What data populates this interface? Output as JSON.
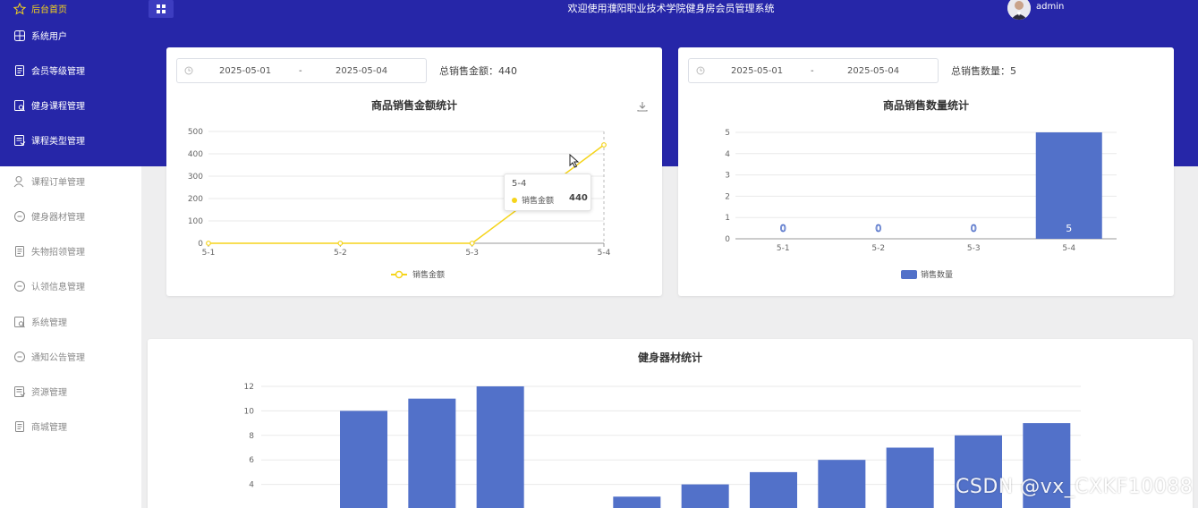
{
  "app": {
    "title": "欢迎使用濮阳职业技术学院健身房会员管理系统",
    "username": "admin",
    "brand_color": "#2626a8"
  },
  "sidebar": {
    "items": [
      {
        "label": "后台首页",
        "icon": "star-icon"
      },
      {
        "label": "系统用户",
        "icon": "grid-icon"
      },
      {
        "label": "会员等级管理",
        "icon": "document-icon"
      },
      {
        "label": "健身课程管理",
        "icon": "file-search-icon"
      },
      {
        "label": "课程类型管理",
        "icon": "file-list-icon"
      },
      {
        "label": "课程订单管理",
        "icon": "user-icon"
      },
      {
        "label": "健身器材管理",
        "icon": "chat-icon"
      },
      {
        "label": "失物招领管理",
        "icon": "document-icon"
      },
      {
        "label": "认领信息管理",
        "icon": "chat-icon"
      },
      {
        "label": "系统管理",
        "icon": "file-search-icon"
      },
      {
        "label": "通知公告管理",
        "icon": "chat-icon"
      },
      {
        "label": "资源管理",
        "icon": "file-list-icon"
      },
      {
        "label": "商城管理",
        "icon": "document-icon"
      }
    ]
  },
  "sales_amount_card": {
    "date_start": "2025-05-01",
    "date_sep": "-",
    "date_end": "2025-05-04",
    "total_label": "总销售金额：440",
    "tooltip": {
      "title": "5-4",
      "series": "销售金额",
      "value": "440"
    }
  },
  "sales_qty_card": {
    "date_start": "2025-05-01",
    "date_sep": "-",
    "date_end": "2025-05-04",
    "total_label": "总销售数量：5"
  },
  "chart_data": [
    {
      "type": "line",
      "title": "商品销售金额统计",
      "categories": [
        "5-1",
        "5-2",
        "5-3",
        "5-4"
      ],
      "series": [
        {
          "name": "销售金额",
          "values": [
            0,
            0,
            0,
            440
          ],
          "color": "#f5d41b"
        }
      ],
      "yticks": [
        0,
        100,
        200,
        300,
        400,
        500
      ],
      "ylim": [
        0,
        500
      ],
      "legend": "bottom-center",
      "grid": true
    },
    {
      "type": "bar",
      "title": "商品销售数量统计",
      "categories": [
        "5-1",
        "5-2",
        "5-3",
        "5-4"
      ],
      "series": [
        {
          "name": "销售数量",
          "values": [
            0,
            0,
            0,
            5
          ],
          "color": "#5271c9"
        }
      ],
      "yticks": [
        0,
        1,
        2,
        3,
        4,
        5
      ],
      "ylim": [
        0,
        5
      ],
      "legend": "bottom-center",
      "data_labels": [
        "0",
        "0",
        "0",
        "5"
      ],
      "grid": true
    },
    {
      "type": "bar",
      "title": "健身器材统计",
      "series": [
        {
          "values": [
            0,
            10,
            11,
            12,
            0,
            3,
            4,
            5,
            6,
            7,
            8,
            9
          ],
          "color": "#5271c9"
        }
      ],
      "yticks": [
        4,
        6,
        8,
        10,
        12
      ],
      "ylim": [
        2,
        12
      ],
      "grid": true
    }
  ],
  "watermark": "CSDN @vx_CXKF10088"
}
